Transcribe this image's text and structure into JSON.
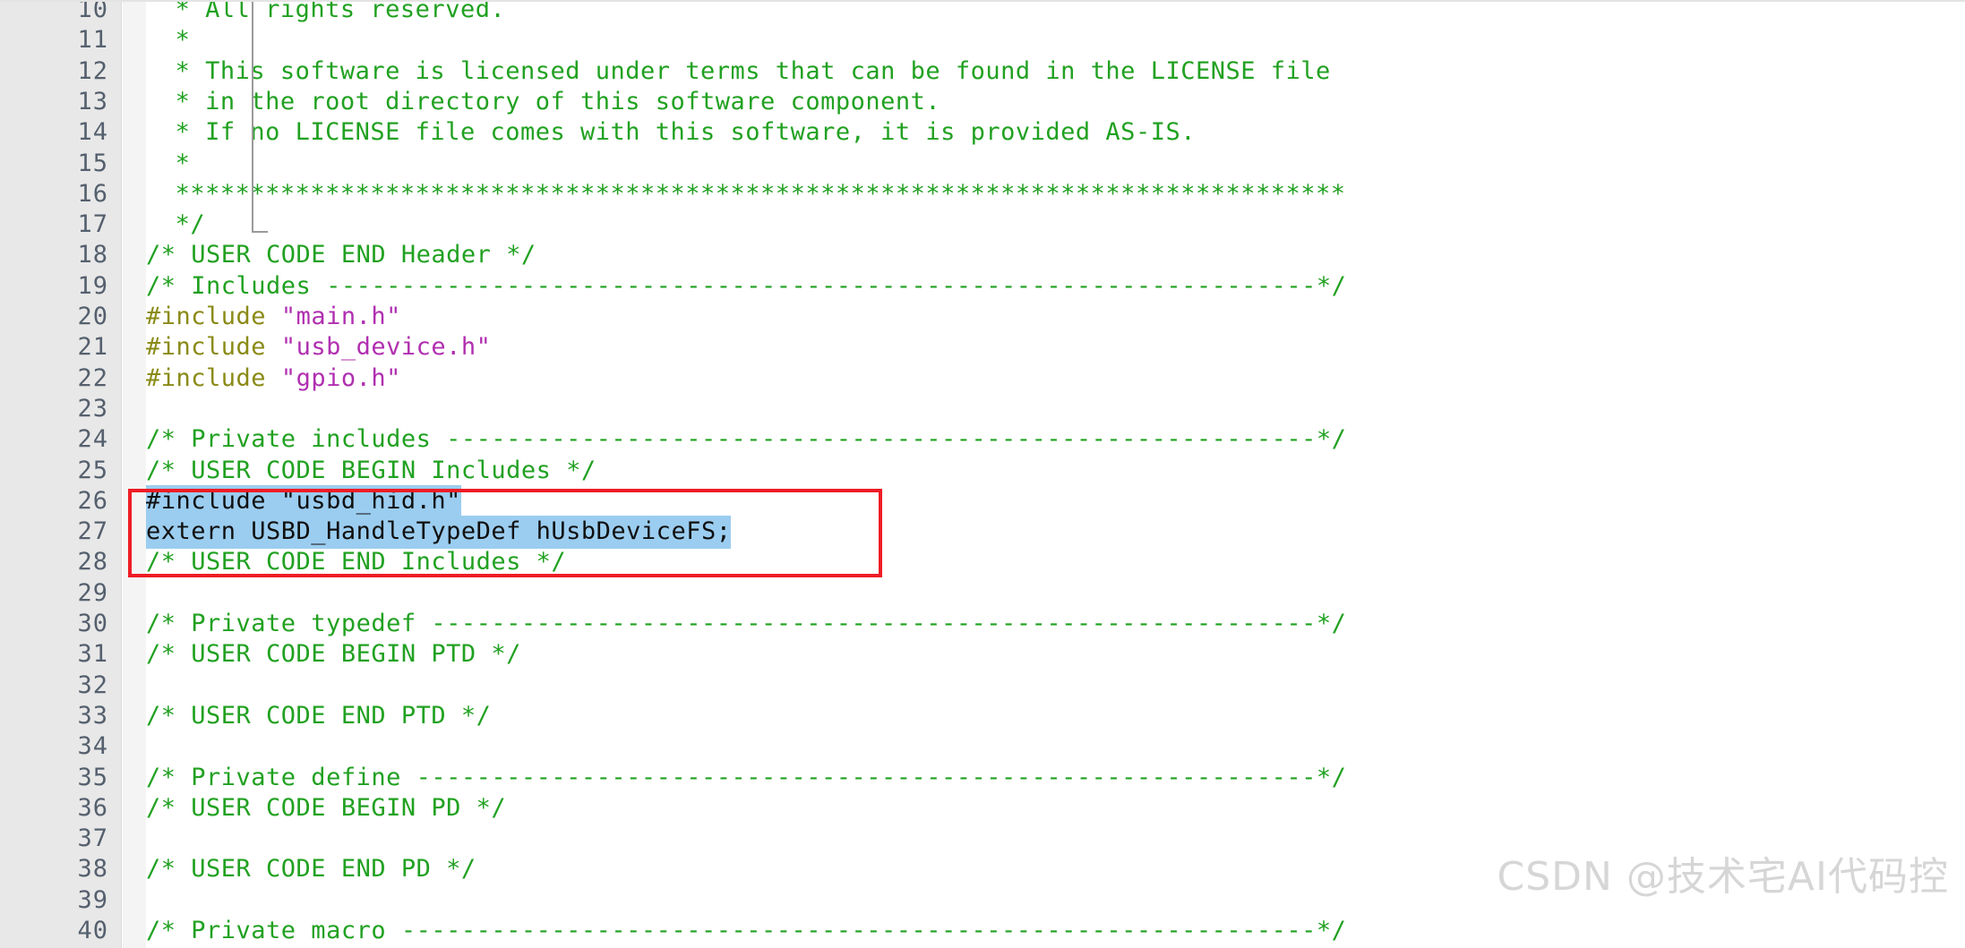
{
  "editor": {
    "language": "c",
    "first_visible_line": 10,
    "last_visible_line": 40,
    "colors": {
      "background": "#ffffff",
      "gutter_background": "#e8e8e8",
      "fold_column_background": "#f4f4f4",
      "line_number": "#55606e",
      "comment": "#21a121",
      "preprocessor": "#8a8a16",
      "string": "#b02fb0",
      "plain_text": "#101010",
      "selection": "#9bcdf0",
      "annotation_box": "#ee1c25",
      "watermark": "#d6d6d6"
    }
  },
  "lines": [
    {
      "num": "10",
      "indent": 2,
      "segments": [
        {
          "text": "* All rights reserved.",
          "type": "comment"
        }
      ]
    },
    {
      "num": "11",
      "indent": 2,
      "segments": [
        {
          "text": "*",
          "type": "comment"
        }
      ]
    },
    {
      "num": "12",
      "indent": 2,
      "segments": [
        {
          "text": "* This software is licensed under terms that can be found in the LICENSE file",
          "type": "comment"
        }
      ]
    },
    {
      "num": "13",
      "indent": 2,
      "segments": [
        {
          "text": "* in the root directory of this software component.",
          "type": "comment"
        }
      ]
    },
    {
      "num": "14",
      "indent": 2,
      "segments": [
        {
          "text": "* If no LICENSE file comes with this software, it is provided AS-IS.",
          "type": "comment"
        }
      ]
    },
    {
      "num": "15",
      "indent": 2,
      "segments": [
        {
          "text": "*",
          "type": "comment"
        }
      ]
    },
    {
      "num": "16",
      "indent": 2,
      "segments": [
        {
          "text": "******************************************************************************",
          "type": "comment"
        }
      ]
    },
    {
      "num": "17",
      "indent": 2,
      "segments": [
        {
          "text": "*/",
          "type": "comment"
        }
      ]
    },
    {
      "num": "18",
      "indent": 0,
      "segments": [
        {
          "text": "/* USER CODE END Header */",
          "type": "comment"
        }
      ]
    },
    {
      "num": "19",
      "indent": 0,
      "segments": [
        {
          "text": "/* Includes ------------------------------------------------------------------*/",
          "type": "comment"
        }
      ]
    },
    {
      "num": "20",
      "indent": 0,
      "segments": [
        {
          "text": "#include ",
          "type": "preprocessor"
        },
        {
          "text": "\"main.h\"",
          "type": "string"
        }
      ]
    },
    {
      "num": "21",
      "indent": 0,
      "segments": [
        {
          "text": "#include ",
          "type": "preprocessor"
        },
        {
          "text": "\"usb_device.h\"",
          "type": "string"
        }
      ]
    },
    {
      "num": "22",
      "indent": 0,
      "segments": [
        {
          "text": "#include ",
          "type": "preprocessor"
        },
        {
          "text": "\"gpio.h\"",
          "type": "string"
        }
      ]
    },
    {
      "num": "23",
      "indent": 0,
      "segments": []
    },
    {
      "num": "24",
      "indent": 0,
      "segments": [
        {
          "text": "/* Private includes ----------------------------------------------------------*/",
          "type": "comment"
        }
      ]
    },
    {
      "num": "25",
      "indent": 0,
      "segments": [
        {
          "text": "/* USER CODE BEGIN Includes */",
          "type": "comment"
        }
      ]
    },
    {
      "num": "26",
      "indent": 0,
      "selected": true,
      "segments": [
        {
          "text": "#include \"usbd_hid.h\"",
          "type": "selected"
        }
      ]
    },
    {
      "num": "27",
      "indent": 0,
      "selected": true,
      "segments": [
        {
          "text": "extern USBD_HandleTypeDef hUsbDeviceFS;",
          "type": "selected"
        }
      ]
    },
    {
      "num": "28",
      "indent": 0,
      "segments": [
        {
          "text": "/* USER CODE END Includes */",
          "type": "comment"
        }
      ]
    },
    {
      "num": "29",
      "indent": 0,
      "segments": []
    },
    {
      "num": "30",
      "indent": 0,
      "segments": [
        {
          "text": "/* Private typedef -----------------------------------------------------------*/",
          "type": "comment"
        }
      ]
    },
    {
      "num": "31",
      "indent": 0,
      "segments": [
        {
          "text": "/* USER CODE BEGIN PTD */",
          "type": "comment"
        }
      ]
    },
    {
      "num": "32",
      "indent": 0,
      "segments": []
    },
    {
      "num": "33",
      "indent": 0,
      "segments": [
        {
          "text": "/* USER CODE END PTD */",
          "type": "comment"
        }
      ]
    },
    {
      "num": "34",
      "indent": 0,
      "segments": []
    },
    {
      "num": "35",
      "indent": 0,
      "segments": [
        {
          "text": "/* Private define ------------------------------------------------------------*/",
          "type": "comment"
        }
      ]
    },
    {
      "num": "36",
      "indent": 0,
      "segments": [
        {
          "text": "/* USER CODE BEGIN PD */",
          "type": "comment"
        }
      ]
    },
    {
      "num": "37",
      "indent": 0,
      "segments": []
    },
    {
      "num": "38",
      "indent": 0,
      "segments": [
        {
          "text": "/* USER CODE END PD */",
          "type": "comment"
        }
      ]
    },
    {
      "num": "39",
      "indent": 0,
      "segments": []
    },
    {
      "num": "40",
      "indent": 0,
      "segments": [
        {
          "text": "/* Private macro -------------------------------------------------------------*/",
          "type": "comment"
        }
      ]
    }
  ],
  "annotation": {
    "type": "rectangle-highlight",
    "color": "#ee1c25",
    "covers_lines": [
      "26",
      "27"
    ]
  },
  "watermark": {
    "text": "CSDN @技术宅AI代码控"
  }
}
